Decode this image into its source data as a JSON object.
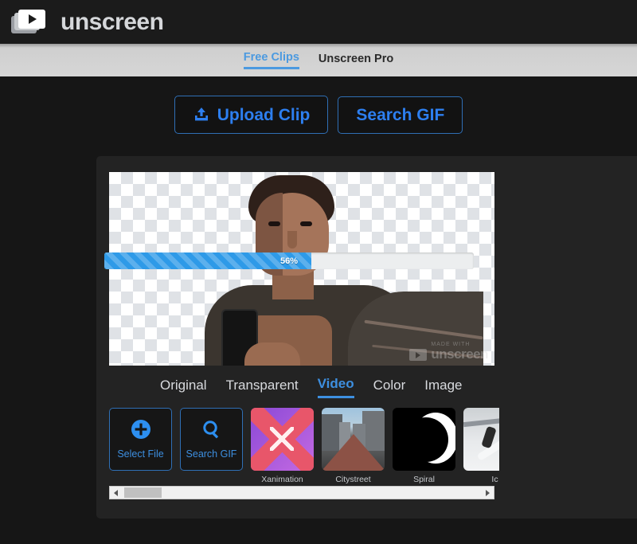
{
  "brand": {
    "name": "unscreen",
    "logo_icon": "video-frames-play-icon"
  },
  "topnav": {
    "tabs": [
      {
        "label": "Free Clips",
        "active": true
      },
      {
        "label": "Unscreen Pro",
        "active": false
      }
    ]
  },
  "actions": {
    "upload": {
      "label": "Upload Clip",
      "icon": "upload-icon"
    },
    "search": {
      "label": "Search GIF",
      "icon": "search-icon"
    }
  },
  "preview": {
    "progress": {
      "percent": 56,
      "label": "56%"
    },
    "watermark": {
      "made_with": "MADE WITH",
      "name": "unscreen"
    }
  },
  "mode_tabs": [
    {
      "label": "Original",
      "active": false
    },
    {
      "label": "Transparent",
      "active": false
    },
    {
      "label": "Video",
      "active": true
    },
    {
      "label": "Color",
      "active": false
    },
    {
      "label": "Image",
      "active": false
    }
  ],
  "picker": {
    "select_file": {
      "label": "Select File",
      "icon": "plus-circle-icon"
    },
    "search_gif": {
      "label": "Search GIF",
      "icon": "search-icon"
    }
  },
  "thumbnails": [
    {
      "label": "Xanimation"
    },
    {
      "label": "Citystreet"
    },
    {
      "label": "Spiral"
    },
    {
      "label": "Ic"
    }
  ],
  "scrollbar": {
    "left_arrow": "chevron-left-icon",
    "right_arrow": "chevron-right-icon"
  },
  "footer": {
    "note": ""
  },
  "colors": {
    "accent_blue": "#2d7ff0",
    "tab_blue": "#4c9ae0",
    "progress_blue": "#2e9ae8",
    "page_bg": "#161616",
    "card_bg": "#232323",
    "header_bg": "#1b1b1b",
    "topnav_bg": "#d6d6d6"
  }
}
